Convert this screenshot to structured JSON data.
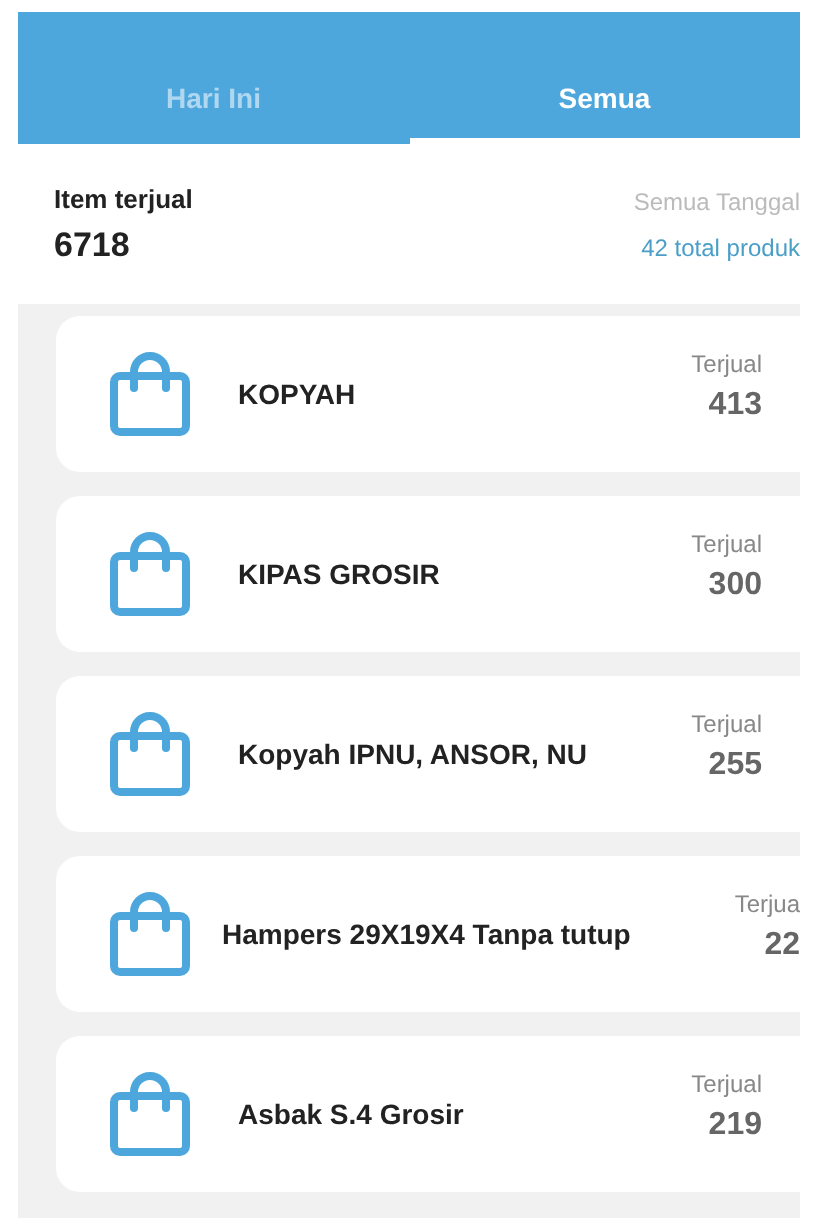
{
  "tabs": [
    {
      "label": "Hari Ini",
      "selected": false
    },
    {
      "label": "Semua",
      "selected": true
    }
  ],
  "summary": {
    "label": "Item terjual",
    "value": "6718",
    "date_filter": "Semua Tanggal",
    "total": "42 total produk"
  },
  "products": [
    {
      "name": "KOPYAH",
      "sold_label": "Terjual",
      "sold": "413"
    },
    {
      "name": "KIPAS GROSIR",
      "sold_label": "Terjual",
      "sold": "300"
    },
    {
      "name": "Kopyah IPNU, ANSOR, NU",
      "sold_label": "Terjual",
      "sold": "255"
    },
    {
      "name": "Hampers 29X19X4 Tanpa tutup",
      "sold_label": "Terjua",
      "sold": "22"
    },
    {
      "name": "Asbak S.4 Grosir",
      "sold_label": "Terjual",
      "sold": "219"
    }
  ]
}
